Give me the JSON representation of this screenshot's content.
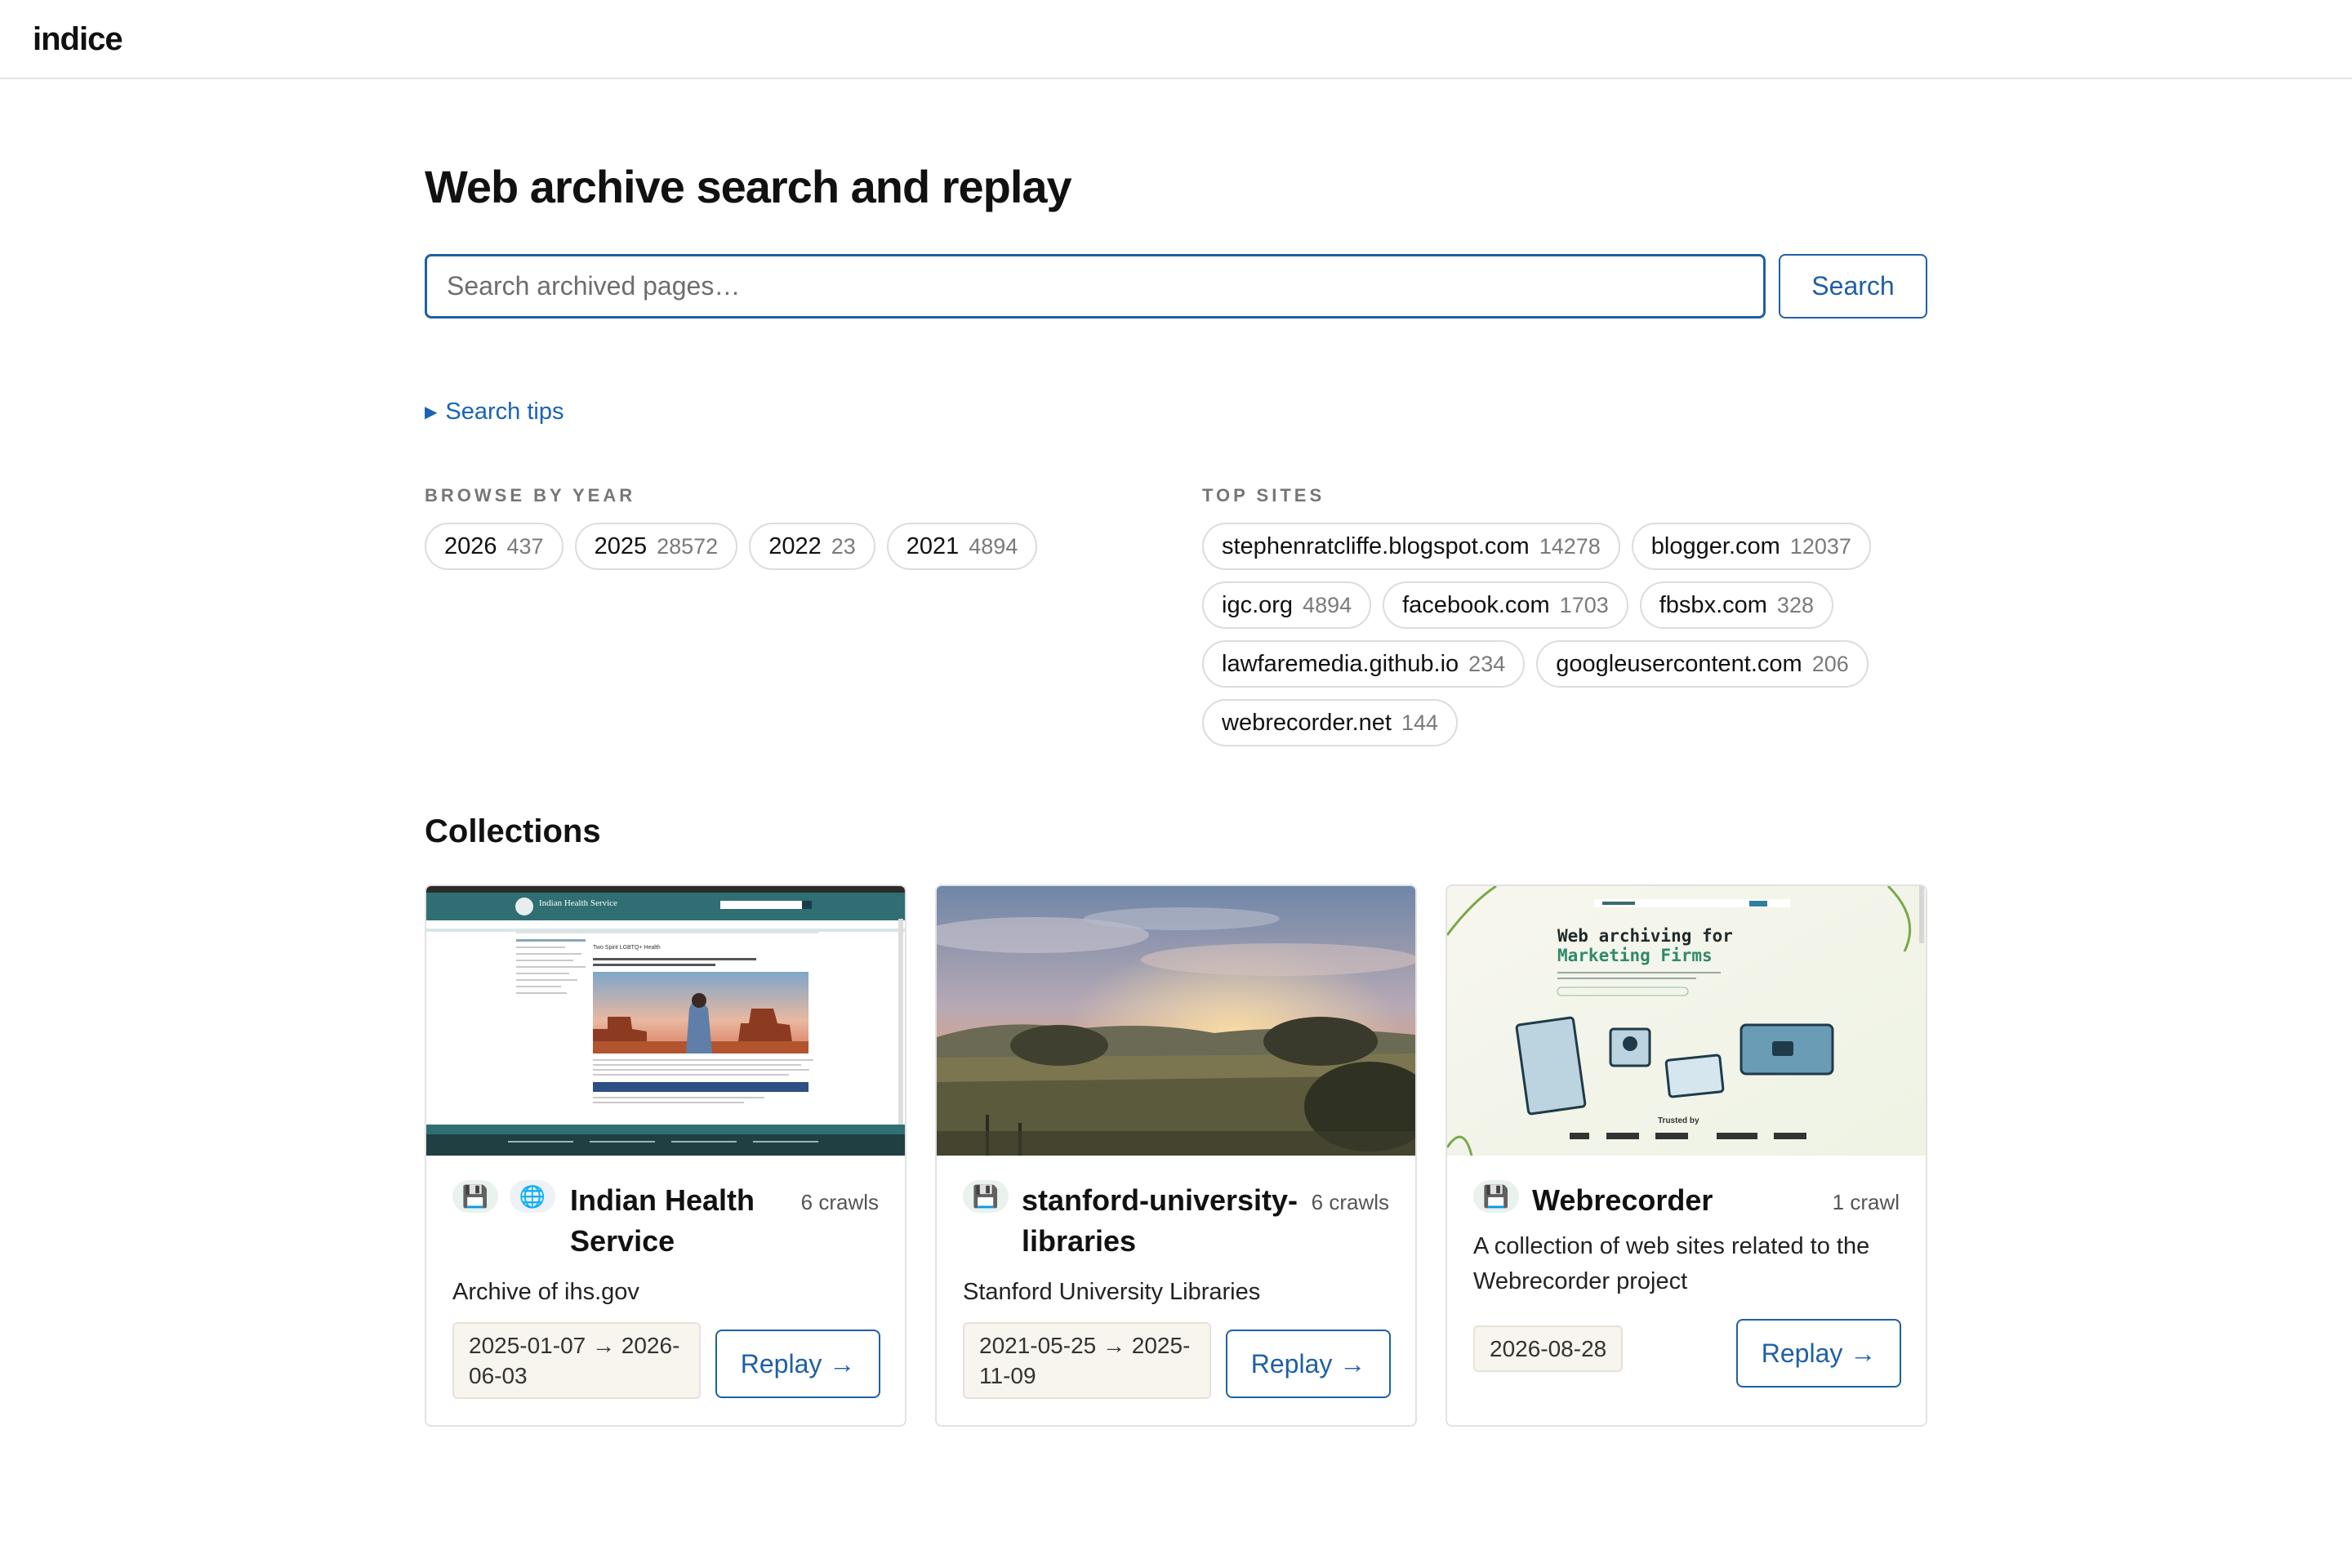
{
  "app": {
    "brand": "indice"
  },
  "page": {
    "title": "Web archive search and replay"
  },
  "search": {
    "placeholder": "Search archived pages…",
    "button_label": "Search"
  },
  "tips": {
    "label": "Search tips",
    "icon": "triangle-right-icon"
  },
  "browse_by_year": {
    "label": "BROWSE BY YEAR",
    "items": [
      {
        "year": "2026",
        "count": "437"
      },
      {
        "year": "2025",
        "count": "28572"
      },
      {
        "year": "2022",
        "count": "23"
      },
      {
        "year": "2021",
        "count": "4894"
      }
    ]
  },
  "top_sites": {
    "label": "TOP SITES",
    "items": [
      {
        "site": "stephenratcliffe.blogspot.com",
        "count": "14278"
      },
      {
        "site": "blogger.com",
        "count": "12037"
      },
      {
        "site": "igc.org",
        "count": "4894"
      },
      {
        "site": "facebook.com",
        "count": "1703"
      },
      {
        "site": "fbsbx.com",
        "count": "328"
      },
      {
        "site": "lawfaremedia.github.io",
        "count": "234"
      },
      {
        "site": "googleusercontent.com",
        "count": "206"
      },
      {
        "site": "webrecorder.net",
        "count": "144"
      }
    ]
  },
  "collections": {
    "title": "Collections",
    "cards": [
      {
        "title": "Indian Health Service",
        "crawls": "6 crawls",
        "description": "Archive of ihs.gov",
        "dates": "2025-01-07 → 2026-06-03",
        "replay_label": "Replay →",
        "icons": [
          "floppy-disk-icon",
          "globe-icon"
        ],
        "thumb": {
          "site_name": "Indian Health Service",
          "page_heading": "Two Spirit LGBTQ+ Health"
        }
      },
      {
        "title": "stanford-university-libraries",
        "crawls": "6 crawls",
        "description": "Stanford University Libraries",
        "dates": "2021-05-25 → 2025-11-09",
        "replay_label": "Replay →",
        "icons": [
          "floppy-disk-icon"
        ]
      },
      {
        "title": "Webrecorder",
        "crawls": "1 crawl",
        "description": "A collection of web sites related to the Webrecorder project",
        "dates": "2026-08-28",
        "replay_label": "Replay →",
        "icons": [
          "floppy-disk-icon"
        ],
        "thumb": {
          "headline_1": "Web archiving for",
          "headline_2": "Marketing Firms",
          "trusted_by": "Trusted by"
        }
      }
    ]
  },
  "colors": {
    "accent": "#1f5fa6",
    "link": "#1a63b3",
    "chip_border": "#dcdcdc"
  }
}
